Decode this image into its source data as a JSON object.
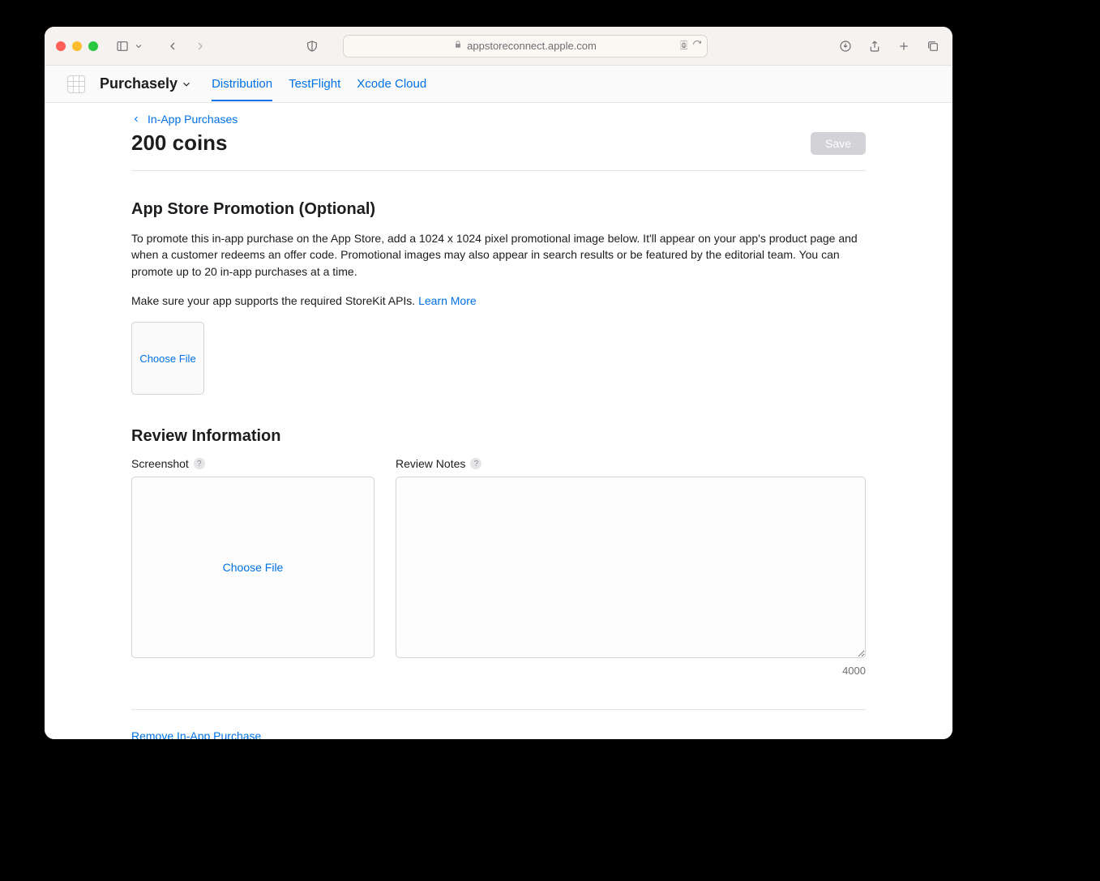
{
  "browser": {
    "url": "appstoreconnect.apple.com"
  },
  "app": {
    "name": "Purchasely",
    "tabs": [
      {
        "label": "Distribution",
        "active": true
      },
      {
        "label": "TestFlight",
        "active": false
      },
      {
        "label": "Xcode Cloud",
        "active": false
      }
    ]
  },
  "breadcrumb": {
    "label": "In-App Purchases"
  },
  "pageTitle": "200 coins",
  "saveLabel": "Save",
  "promo": {
    "heading": "App Store Promotion (Optional)",
    "desc1": "To promote this in-app purchase on the App Store, add a 1024 x 1024 pixel promotional image below. It'll appear on your app's product page and when a customer redeems an offer code. Promotional images may also appear in search results or be featured by the editorial team. You can promote up to 20 in-app purchases at a time.",
    "desc2a": "Make sure your app supports the required StoreKit APIs. ",
    "learnMore": "Learn More",
    "chooseFile": "Choose File"
  },
  "review": {
    "heading": "Review Information",
    "screenshotLabel": "Screenshot",
    "notesLabel": "Review Notes",
    "chooseFile": "Choose File",
    "notesValue": "",
    "counter": "4000"
  },
  "removeLabel": "Remove In-App Purchase"
}
